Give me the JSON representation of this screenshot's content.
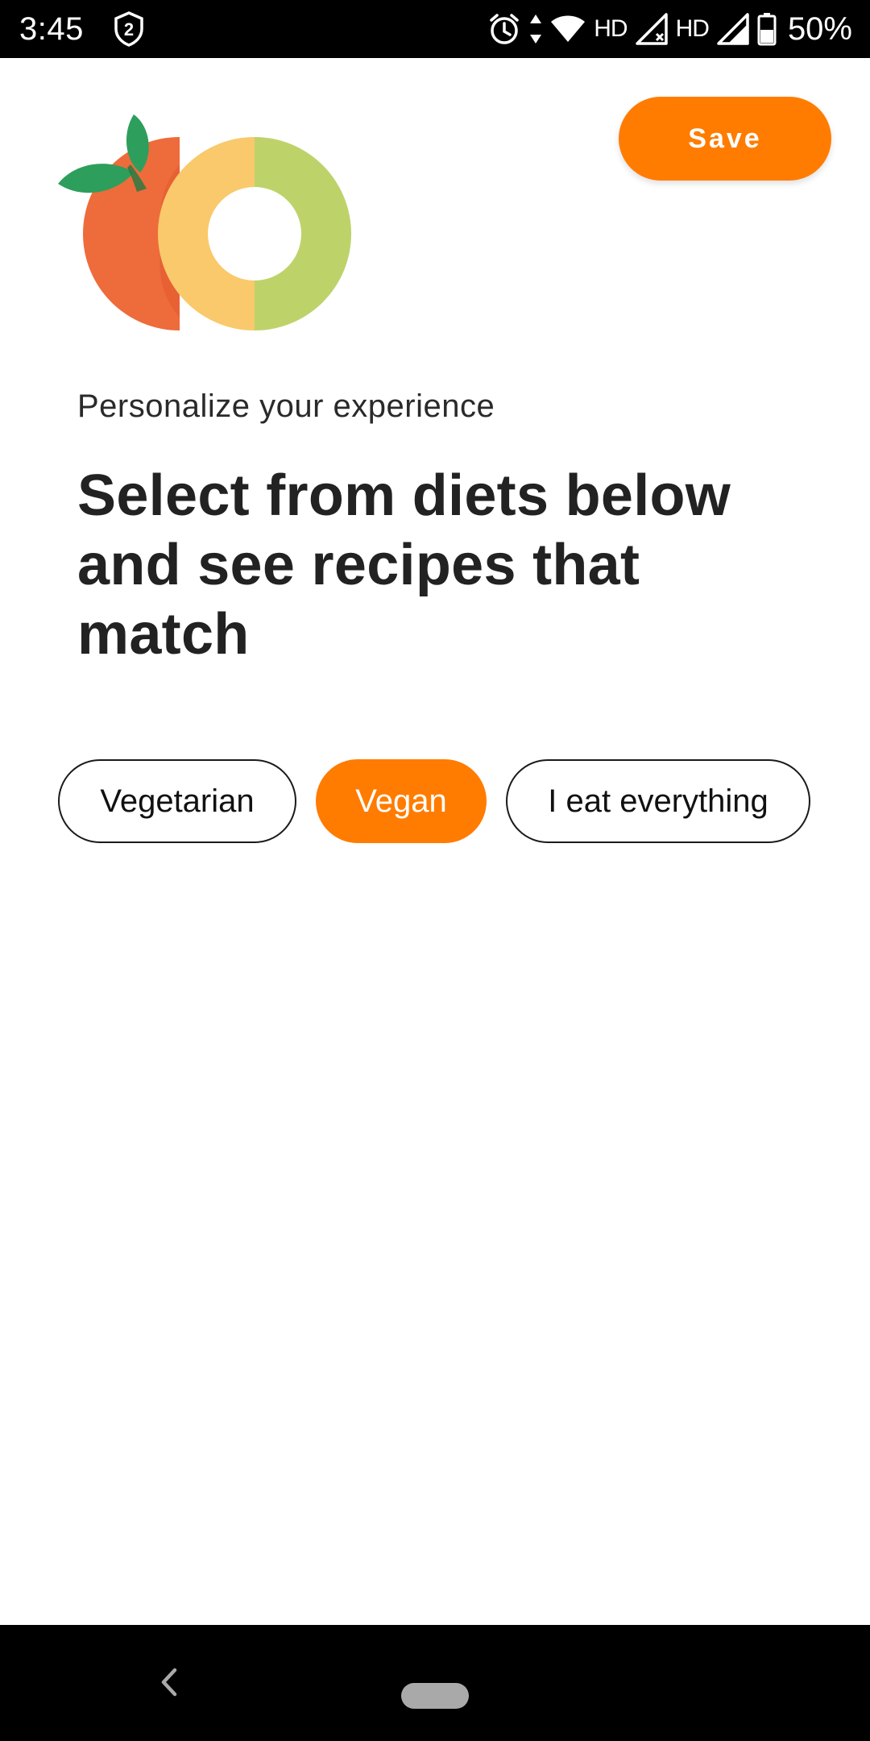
{
  "status_bar": {
    "time": "3:45",
    "notification_badge": "2",
    "network_label_1": "HD",
    "network_label_2": "HD",
    "battery_percent": "50%",
    "icons": [
      "shield-badge-icon",
      "alarm-icon",
      "data-arrows-icon",
      "wifi-icon",
      "signal-icon",
      "signal-icon",
      "battery-icon"
    ]
  },
  "header": {
    "save_label": "Save"
  },
  "content": {
    "subtitle": "Personalize your experience",
    "headline": "Select from diets below and see recipes that match"
  },
  "diets": {
    "options": [
      {
        "label": "Vegetarian",
        "selected": false
      },
      {
        "label": "Vegan",
        "selected": true
      },
      {
        "label": "I eat everything",
        "selected": false
      }
    ]
  },
  "colors": {
    "accent": "#FF7C00",
    "status_bar": "#000000",
    "text": "#222222"
  },
  "navigation": {
    "icons": [
      "back-icon",
      "home-pill-icon"
    ]
  }
}
